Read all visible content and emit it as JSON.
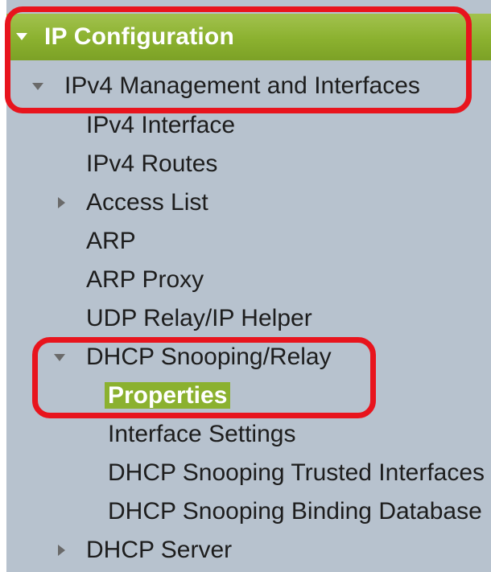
{
  "header": {
    "title": "IP Configuration",
    "expand_icon": "caret-down-icon"
  },
  "colors": {
    "header_green": "#8bb12f",
    "panel_bg": "#b7c2ce",
    "selected_bg": "#8bb12f",
    "callout_red": "#e8141d"
  },
  "nav": {
    "group": {
      "label": "IPv4 Management and Interfaces",
      "expanded": true,
      "icon": "caret-down-icon"
    },
    "items": {
      "ipv4_interface": "IPv4 Interface",
      "ipv4_routes": "IPv4 Routes",
      "access_list": "Access List",
      "arp": "ARP",
      "arp_proxy": "ARP Proxy",
      "udp_relay": "UDP Relay/IP Helper",
      "dhcp_snooping_relay": "DHCP Snooping/Relay",
      "dhcp_server": "DHCP Server"
    },
    "dhcp_snooping_children": {
      "properties": "Properties",
      "interface_settings": "Interface Settings",
      "trusted_interfaces": "DHCP Snooping Trusted Interfaces",
      "binding_database": "DHCP Snooping Binding Database"
    },
    "selected": "Properties"
  }
}
